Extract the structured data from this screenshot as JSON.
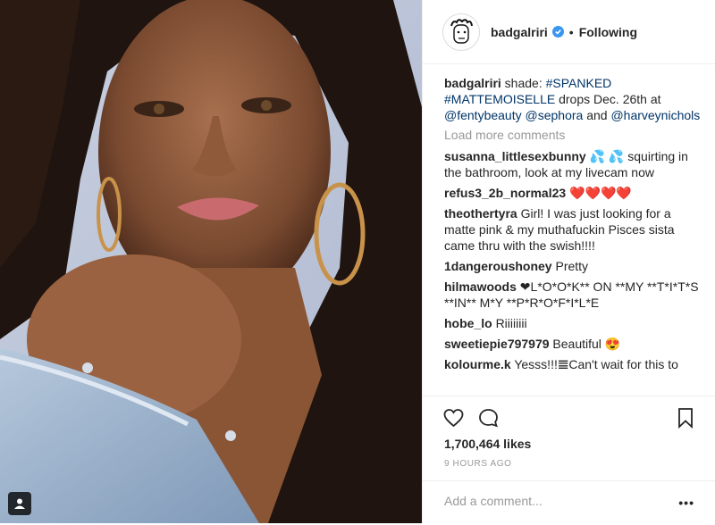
{
  "post": {
    "username": "badgalriri",
    "separator": "•",
    "follow_status": "Following",
    "verified_icon": "verified-badge-icon",
    "accent_color": "#3897f0"
  },
  "caption": {
    "username": "badgalriri",
    "text_1": " shade: ",
    "tag_1": "#SPANKED",
    "tag_2": "#MATTEMOISELLE",
    "text_2": " drops Dec. 26th at ",
    "mention_1": "@fentybeauty",
    "mention_2": "@sephora",
    "text_3": " and ",
    "mention_3": "@harveynichols"
  },
  "load_more": "Load more comments",
  "comments": [
    {
      "user": "susanna_littlesexbunny",
      "text": "💦 💦 squirting in the bathroom, look at my livecam now"
    },
    {
      "user": "refus3_2b_normal23",
      "text": "❤️❤️❤️❤️"
    },
    {
      "user": "theothertyra",
      "text": "Girl! I was just looking for a matte pink & my muthafuckin Pisces sista came thru with the swish!!!!"
    },
    {
      "user": "1dangeroushoney",
      "text": "Pretty"
    },
    {
      "user": "hilmawoods",
      "text": "❤L*O*O*K** ON **MY **T*I*T*S **IN** M*Y **P*R*O*F*I*L*E"
    },
    {
      "user": "hobe_lo",
      "text": "Riiiiiiii"
    },
    {
      "user": "sweetiepie797979",
      "text": "Beautiful 😍"
    },
    {
      "user": "kolourme.k",
      "text": "Yesss!!!𝌆Can't wait for this to"
    }
  ],
  "likes": "1,700,464 likes",
  "timestamp": "9 HOURS AGO",
  "add_comment_placeholder": "Add a comment...",
  "more_label": "•••",
  "icons": {
    "like": "heart-outline-icon",
    "comment": "speech-bubble-icon",
    "save": "bookmark-icon",
    "tagged": "person-tag-icon"
  }
}
